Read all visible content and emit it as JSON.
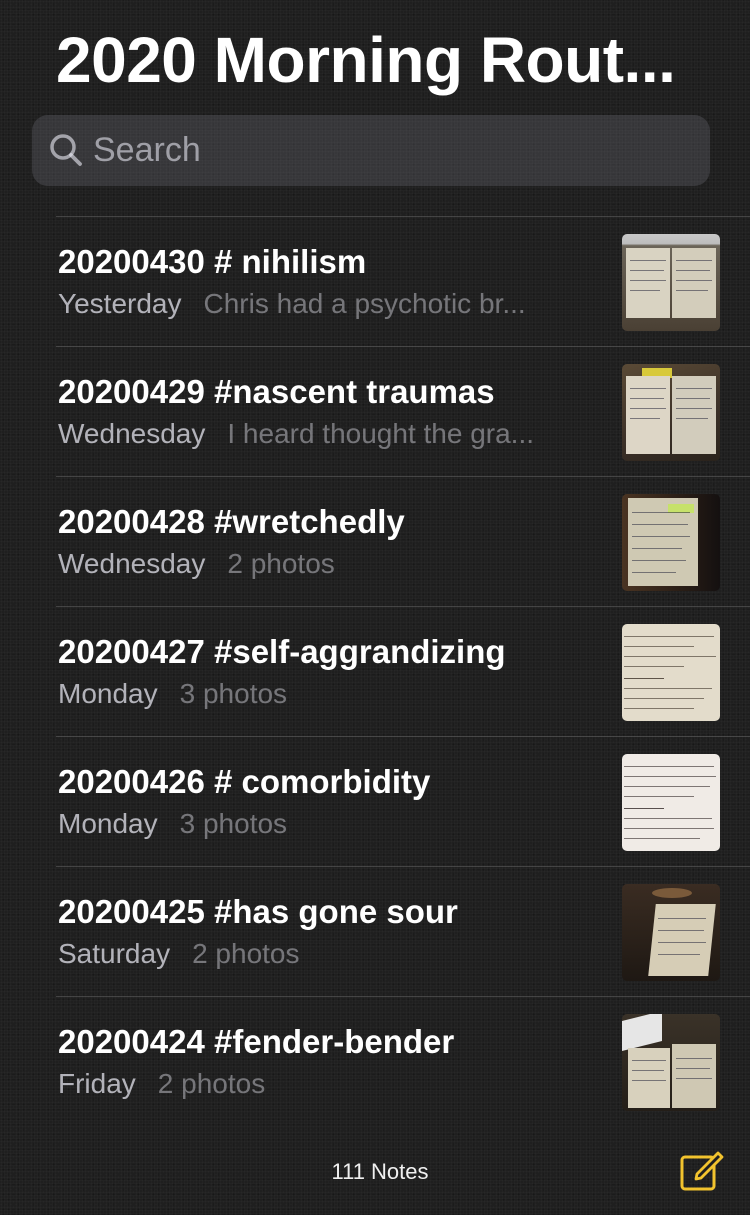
{
  "header": {
    "title": "2020 Morning Rout..."
  },
  "search": {
    "placeholder": "Search",
    "icon": "search-icon"
  },
  "notes": [
    {
      "title": "20200430 # nihilism",
      "date": "Yesterday",
      "snippet": "Chris had a psychotic br..."
    },
    {
      "title": "20200429 #nascent traumas",
      "date": "Wednesday",
      "snippet": "I heard thought the gra..."
    },
    {
      "title": "20200428 #wretchedly",
      "date": "Wednesday",
      "snippet": "2 photos"
    },
    {
      "title": "20200427 #self-aggrandizing",
      "date": "Monday",
      "snippet": "3 photos"
    },
    {
      "title": "20200426 # comorbidity",
      "date": "Monday",
      "snippet": "3 photos"
    },
    {
      "title": "20200425 #has gone sour",
      "date": "Saturday",
      "snippet": "2 photos"
    },
    {
      "title": "20200424 #fender-bender",
      "date": "Friday",
      "snippet": "2 photos"
    }
  ],
  "footer": {
    "count": "111 Notes",
    "compose_icon": "compose-icon"
  },
  "colors": {
    "background": "#1f1f1f",
    "accent": "#f2c32e",
    "text_primary": "#ffffff",
    "text_secondary": "#ebebf5"
  }
}
